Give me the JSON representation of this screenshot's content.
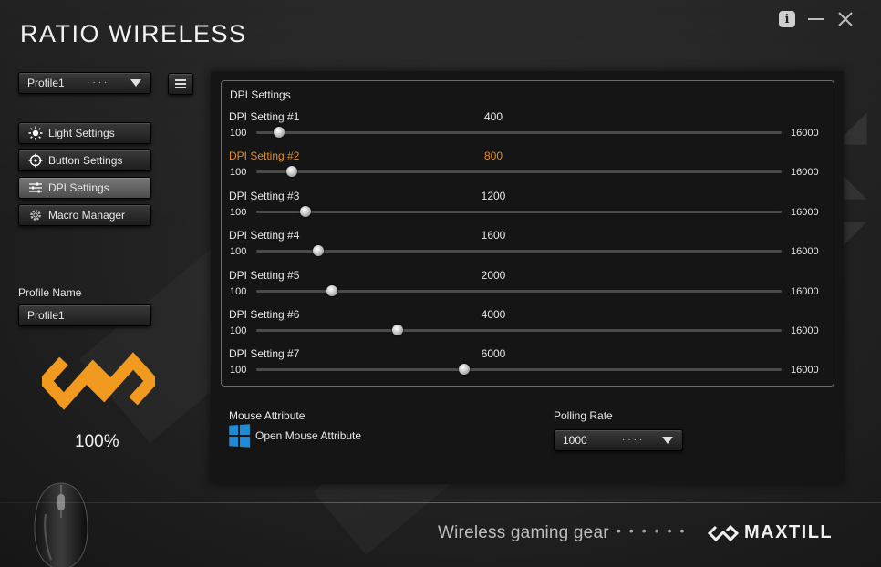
{
  "window": {
    "title": "RATIO WIRELESS",
    "controls": {
      "info": "i"
    }
  },
  "sidebar": {
    "profile_select": {
      "value": "Profile1",
      "dots": "····"
    },
    "nav": [
      {
        "label": "Light Settings",
        "icon": "sun-icon",
        "active": false
      },
      {
        "label": "Button Settings",
        "icon": "crosshair-icon",
        "active": false
      },
      {
        "label": "DPI Settings",
        "icon": "sliders-icon",
        "active": true
      },
      {
        "label": "Macro Manager",
        "icon": "gear-icon",
        "active": false
      }
    ],
    "profile_name": {
      "label": "Profile Name",
      "value": "Profile1"
    },
    "battery": "100%"
  },
  "dpi": {
    "title": "DPI Settings",
    "min_label": "100",
    "max_label": "16000",
    "range": [
      100,
      16000
    ],
    "highlight_color": "#e98b1e",
    "settings": [
      {
        "label": "DPI Setting #1",
        "value": "400",
        "dpi": 400,
        "highlighted": false
      },
      {
        "label": "DPI Setting #2",
        "value": "800",
        "dpi": 800,
        "highlighted": true
      },
      {
        "label": "DPI Setting #3",
        "value": "1200",
        "dpi": 1200,
        "highlighted": false
      },
      {
        "label": "DPI Setting #4",
        "value": "1600",
        "dpi": 1600,
        "highlighted": false
      },
      {
        "label": "DPI Setting #5",
        "value": "2000",
        "dpi": 2000,
        "highlighted": false
      },
      {
        "label": "DPI Setting #6",
        "value": "4000",
        "dpi": 4000,
        "highlighted": false
      },
      {
        "label": "DPI Setting #7",
        "value": "6000",
        "dpi": 6000,
        "highlighted": false
      }
    ]
  },
  "mouse_attribute": {
    "label": "Mouse Attribute",
    "link": "Open Mouse Attribute"
  },
  "polling": {
    "label": "Polling Rate",
    "value": "1000",
    "dots": "····"
  },
  "footer": {
    "tagline": "Wireless gaming gear",
    "dots": "••••••",
    "brand": "MAXTILL"
  },
  "colors": {
    "accent_orange": "#f29a1f",
    "windows_blue": "#1f8ad6"
  }
}
